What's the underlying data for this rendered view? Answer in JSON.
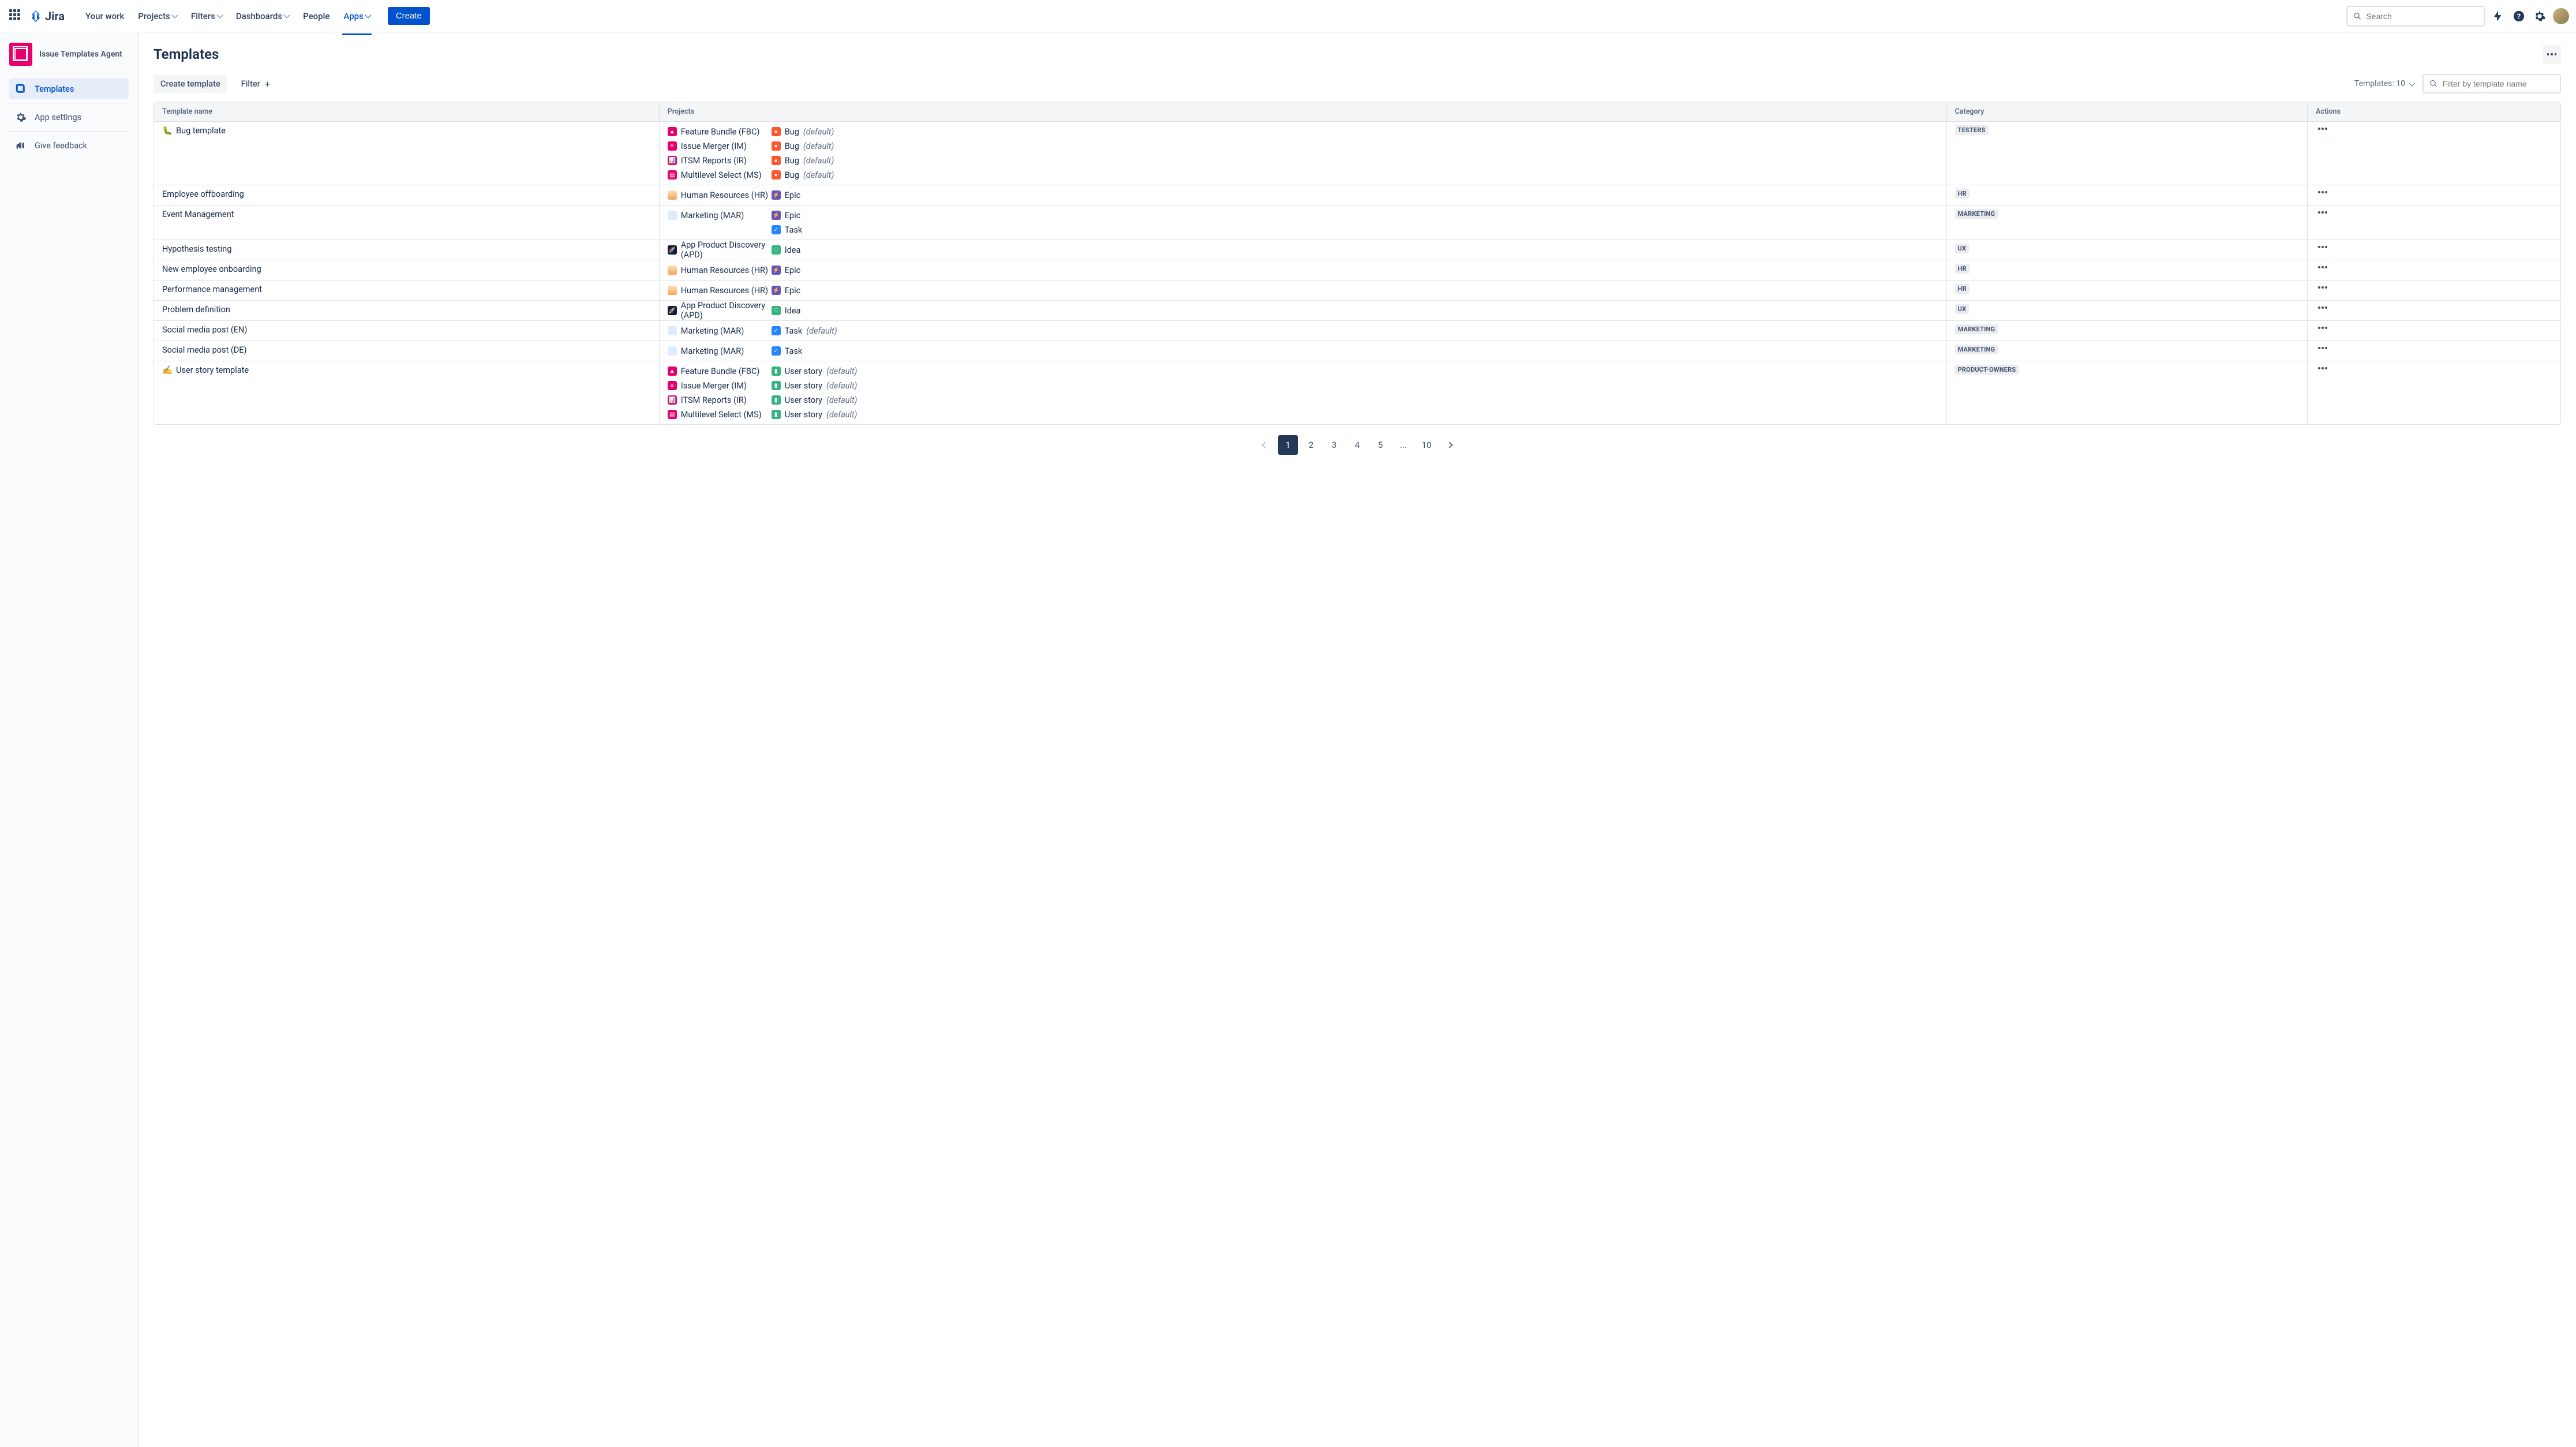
{
  "topbar": {
    "logo": "Jira",
    "nav": {
      "your_work": "Your work",
      "projects": "Projects",
      "filters": "Filters",
      "dashboards": "Dashboards",
      "people": "People",
      "apps": "Apps"
    },
    "create": "Create",
    "search_placeholder": "Search"
  },
  "sidebar": {
    "project": "Issue Templates Agent",
    "items": {
      "templates": "Templates",
      "settings": "App settings",
      "feedback": "Give feedback"
    }
  },
  "page": {
    "title": "Templates",
    "create_template": "Create template",
    "filter": "Filter",
    "page_label": "Templates: 10",
    "filter_placeholder": "Filter by template name"
  },
  "columns": {
    "name": "Template name",
    "projects": "Projects",
    "category": "Category",
    "actions": "Actions"
  },
  "rows": [
    {
      "emoji": "🐛",
      "name": "Bug template",
      "category": "TESTERS",
      "projects": [
        {
          "icon": "pink",
          "iconGlyph": "▲",
          "label": "Feature Bundle (FBC)",
          "typeIcon": "bug",
          "typeGlyph": "●",
          "type": "Bug",
          "default": true
        },
        {
          "icon": "pink",
          "iconGlyph": "≡",
          "label": "Issue Merger (IM)",
          "typeIcon": "bug",
          "typeGlyph": "●",
          "type": "Bug",
          "default": true
        },
        {
          "icon": "pink",
          "iconGlyph": "📊",
          "label": "ITSM Reports (IR)",
          "typeIcon": "bug",
          "typeGlyph": "●",
          "type": "Bug",
          "default": true
        },
        {
          "icon": "pink",
          "iconGlyph": "▤",
          "label": "Multilevel Select (MS)",
          "typeIcon": "bug",
          "typeGlyph": "●",
          "type": "Bug",
          "default": true
        }
      ]
    },
    {
      "emoji": "",
      "name": "Employee offboarding",
      "category": "HR",
      "projects": [
        {
          "icon": "avatar-s",
          "iconGlyph": "",
          "label": "Human Resources (HR)",
          "typeIcon": "epic",
          "typeGlyph": "⚡",
          "type": "Epic",
          "default": false
        }
      ]
    },
    {
      "emoji": "",
      "name": "Event Management",
      "category": "MARKETING",
      "projects": [
        {
          "icon": "mkt",
          "iconGlyph": "",
          "label": "Marketing (MAR)",
          "typeIcon": "epic",
          "typeGlyph": "⚡",
          "type": "Epic",
          "default": false
        },
        {
          "icon": "",
          "iconGlyph": "",
          "label": "",
          "typeIcon": "task",
          "typeGlyph": "✓",
          "type": "Task",
          "default": false
        }
      ]
    },
    {
      "emoji": "",
      "name": "Hypothesis testing",
      "category": "UX",
      "projects": [
        {
          "icon": "rocket",
          "iconGlyph": "🚀",
          "label": "App Product Discovery (APD)",
          "typeIcon": "idea",
          "typeGlyph": "♡",
          "type": "Idea",
          "default": false
        }
      ]
    },
    {
      "emoji": "",
      "name": "New employee onboarding",
      "category": "HR",
      "projects": [
        {
          "icon": "avatar-s",
          "iconGlyph": "",
          "label": "Human Resources (HR)",
          "typeIcon": "epic",
          "typeGlyph": "⚡",
          "type": "Epic",
          "default": false
        }
      ]
    },
    {
      "emoji": "",
      "name": "Performance management",
      "category": "HR",
      "projects": [
        {
          "icon": "avatar-s",
          "iconGlyph": "",
          "label": "Human Resources (HR)",
          "typeIcon": "epic",
          "typeGlyph": "⚡",
          "type": "Epic",
          "default": false
        }
      ]
    },
    {
      "emoji": "",
      "name": "Problem definition",
      "category": "UX",
      "projects": [
        {
          "icon": "rocket",
          "iconGlyph": "🚀",
          "label": "App Product Discovery (APD)",
          "typeIcon": "idea",
          "typeGlyph": "♡",
          "type": "Idea",
          "default": false
        }
      ]
    },
    {
      "emoji": "",
      "name": "Social media post (EN)",
      "category": "MARKETING",
      "projects": [
        {
          "icon": "mkt",
          "iconGlyph": "",
          "label": "Marketing (MAR)",
          "typeIcon": "task",
          "typeGlyph": "✓",
          "type": "Task",
          "default": true
        }
      ]
    },
    {
      "emoji": "",
      "name": "Social media post (DE)",
      "category": "MARKETING",
      "projects": [
        {
          "icon": "mkt",
          "iconGlyph": "",
          "label": "Marketing (MAR)",
          "typeIcon": "task",
          "typeGlyph": "✓",
          "type": "Task",
          "default": false
        }
      ]
    },
    {
      "emoji": "✍️",
      "name": "User story template",
      "category": "PRODUCT-OWNERS",
      "projects": [
        {
          "icon": "pink",
          "iconGlyph": "▲",
          "label": "Feature Bundle (FBC)",
          "typeIcon": "story",
          "typeGlyph": "▮",
          "type": "User story",
          "default": true
        },
        {
          "icon": "pink",
          "iconGlyph": "≡",
          "label": "Issue Merger (IM)",
          "typeIcon": "story",
          "typeGlyph": "▮",
          "type": "User story",
          "default": true
        },
        {
          "icon": "pink",
          "iconGlyph": "📊",
          "label": "ITSM Reports (IR)",
          "typeIcon": "story",
          "typeGlyph": "▮",
          "type": "User story",
          "default": true
        },
        {
          "icon": "pink",
          "iconGlyph": "▤",
          "label": "Multilevel Select (MS)",
          "typeIcon": "story",
          "typeGlyph": "▮",
          "type": "User story",
          "default": true
        }
      ]
    }
  ],
  "pagination": {
    "pages": [
      "1",
      "2",
      "3",
      "4",
      "5",
      "...",
      "10"
    ],
    "active": 0
  },
  "default_label": "(default)"
}
